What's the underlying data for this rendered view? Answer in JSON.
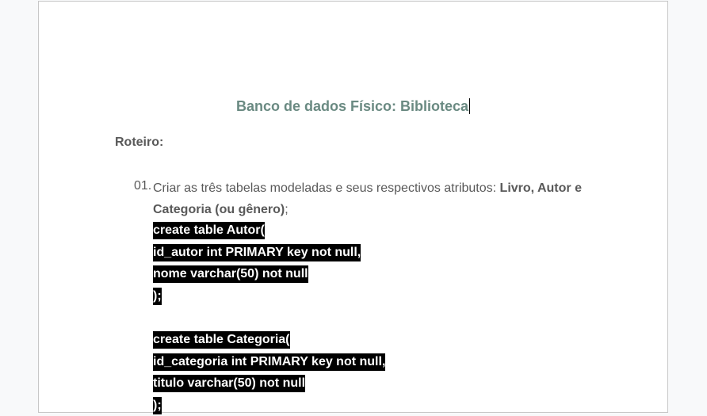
{
  "document": {
    "title": "Banco de dados Físico:  Biblioteca",
    "section_label": "Roteiro:",
    "item_number": "01.",
    "item_text_plain": "Criar as três tabelas modeladas e seus respectivos atributos: ",
    "item_text_bold": "Livro, Autor e Categoria (ou gênero)",
    "item_text_end": ";",
    "code_lines": [
      "create table Autor(",
      "id_autor int PRIMARY key not null,",
      "nome varchar(50) not null",
      ");",
      "",
      "create table Categoria(",
      "id_categoria int PRIMARY key not null,",
      "titulo varchar(50) not null",
      ");"
    ]
  },
  "colors": {
    "title": "#6a8a82",
    "body_text": "#595959",
    "highlight_bg": "#000000",
    "highlight_fg": "#ffffff"
  }
}
